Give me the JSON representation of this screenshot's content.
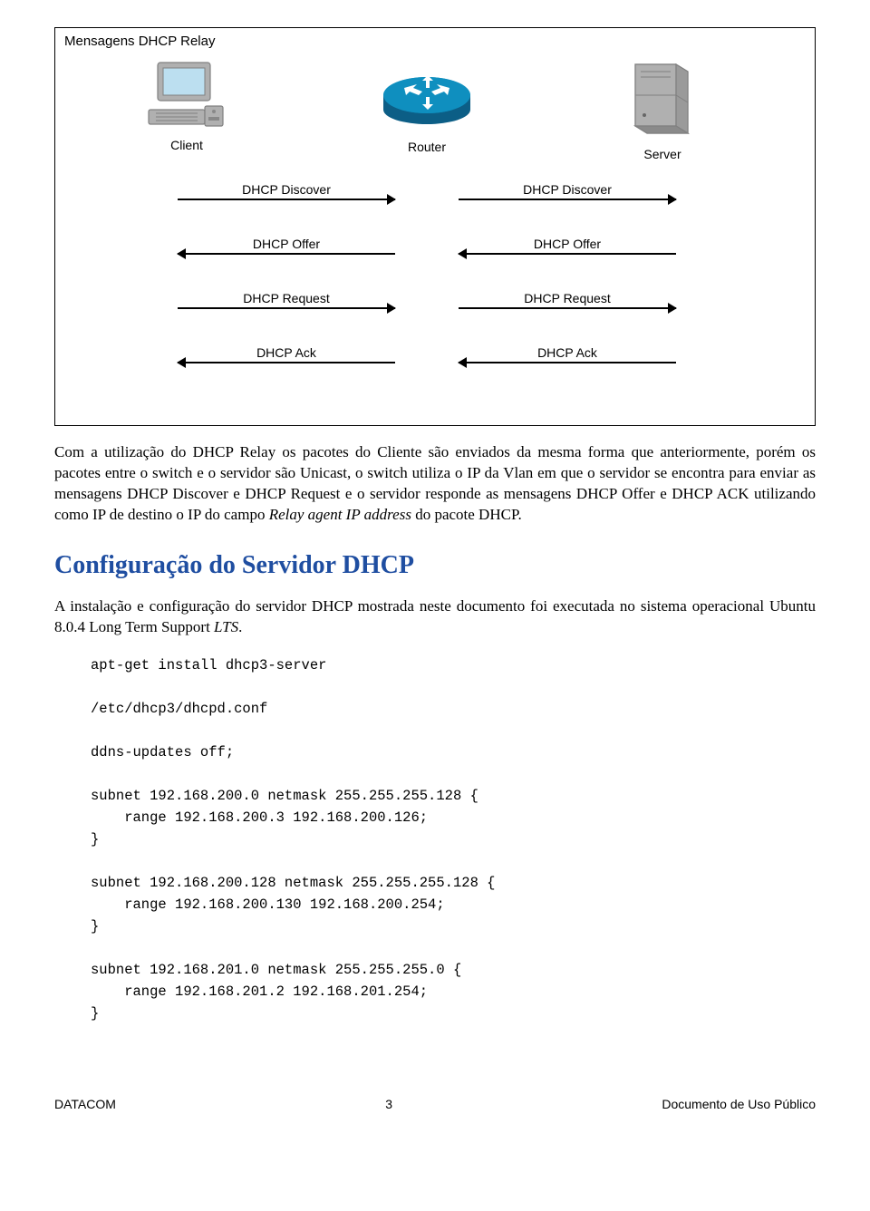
{
  "diagram": {
    "title": "Mensagens DHCP Relay",
    "client_label": "Client",
    "router_label": "Router",
    "server_label": "Server",
    "arrows": {
      "discover": "DHCP Discover",
      "offer": "DHCP Offer",
      "request": "DHCP Request",
      "ack": "DHCP Ack"
    }
  },
  "para1_a": "Com a utilização do DHCP Relay os pacotes do Cliente são enviados da mesma forma que anteriormente, porém os pacotes entre o switch e o servidor são Unicast, o switch utiliza o IP da Vlan em que o servidor se encontra para enviar as mensagens DHCP Discover e DHCP Request e o servidor responde as mensagens DHCP Offer e DHCP ACK utilizando como IP de destino o IP do campo ",
  "para1_b": "Relay agent IP address",
  "para1_c": " do pacote DHCP.",
  "section_title": "Configuração do Servidor DHCP",
  "para2_a": "A instalação e configuração do servidor DHCP mostrada neste documento foi executada no sistema operacional Ubuntu 8.0.4 Long Term Support ",
  "para2_b": "LTS",
  "para2_c": ".",
  "code_text": "apt-get install dhcp3-server\n\n/etc/dhcp3/dhcpd.conf\n\nddns-updates off;\n\nsubnet 192.168.200.0 netmask 255.255.255.128 {\n    range 192.168.200.3 192.168.200.126;\n}\n\nsubnet 192.168.200.128 netmask 255.255.255.128 {\n    range 192.168.200.130 192.168.200.254;\n}\n\nsubnet 192.168.201.0 netmask 255.255.255.0 {\n    range 192.168.201.2 192.168.201.254;\n}",
  "footer": {
    "left": "DATACOM",
    "center": "3",
    "right": "Documento de Uso Público"
  }
}
